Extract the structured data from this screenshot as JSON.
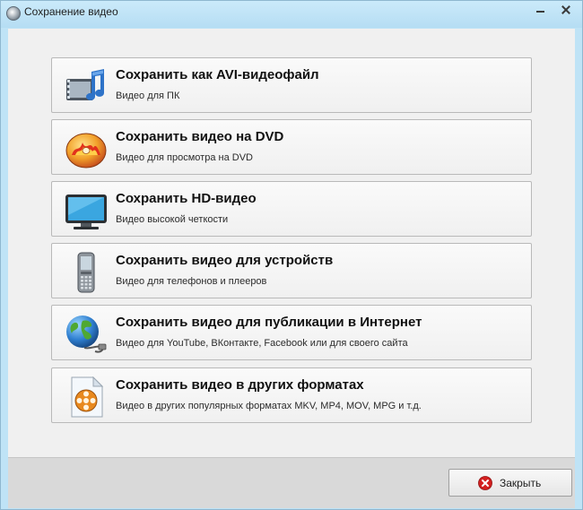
{
  "window": {
    "title": "Сохранение видео"
  },
  "options": [
    {
      "label": "Сохранить как AVI-видеофайл",
      "desc": "Видео для ПК",
      "icon": "film-music-icon"
    },
    {
      "label": "Сохранить видео на DVD",
      "desc": "Видео для просмотра на DVD",
      "icon": "dvd-disc-icon"
    },
    {
      "label": "Сохранить HD-видео",
      "desc": "Видео высокой четкости",
      "icon": "monitor-icon"
    },
    {
      "label": "Сохранить видео для устройств",
      "desc": "Видео для телефонов и плееров",
      "icon": "mobile-phone-icon"
    },
    {
      "label": "Сохранить видео для публикации в Интернет",
      "desc": "Видео для YouTube, ВКонтакте, Facebook или для своего сайта",
      "icon": "globe-icon"
    },
    {
      "label": "Сохранить видео в других форматах",
      "desc": "Видео в других популярных форматах MKV, MP4, MOV, MPG и т.д.",
      "icon": "film-reel-document-icon"
    }
  ],
  "footer": {
    "close_label": "Закрыть"
  },
  "colors": {
    "titlebar": "#bfe3f6",
    "client": "#f0f0f0",
    "footer": "#d9d9d9",
    "close_icon": "#d32020"
  }
}
